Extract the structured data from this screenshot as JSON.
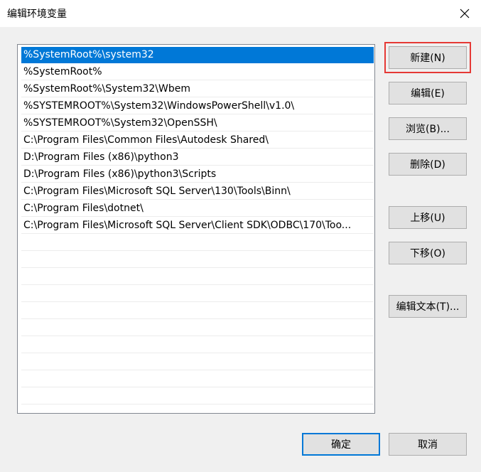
{
  "window": {
    "title": "编辑环境变量",
    "close_icon": "close-icon"
  },
  "list": {
    "items": [
      "%SystemRoot%\\system32",
      "%SystemRoot%",
      "%SystemRoot%\\System32\\Wbem",
      "%SYSTEMROOT%\\System32\\WindowsPowerShell\\v1.0\\",
      "%SYSTEMROOT%\\System32\\OpenSSH\\",
      "C:\\Program Files\\Common Files\\Autodesk Shared\\",
      "D:\\Program Files (x86)\\python3",
      "D:\\Program Files (x86)\\python3\\Scripts",
      "C:\\Program Files\\Microsoft SQL Server\\130\\Tools\\Binn\\",
      "C:\\Program Files\\dotnet\\",
      "C:\\Program Files\\Microsoft SQL Server\\Client SDK\\ODBC\\170\\Too..."
    ],
    "selected_index": 0,
    "selection_color": "#0078d7"
  },
  "buttons": {
    "new": "新建(N)",
    "edit": "编辑(E)",
    "browse": "浏览(B)...",
    "delete": "删除(D)",
    "move_up": "上移(U)",
    "move_down": "下移(O)",
    "edit_text": "编辑文本(T)...",
    "ok": "确定",
    "cancel": "取消"
  },
  "colors": {
    "highlight_outline": "#e53935",
    "primary_border": "#0078d7"
  }
}
